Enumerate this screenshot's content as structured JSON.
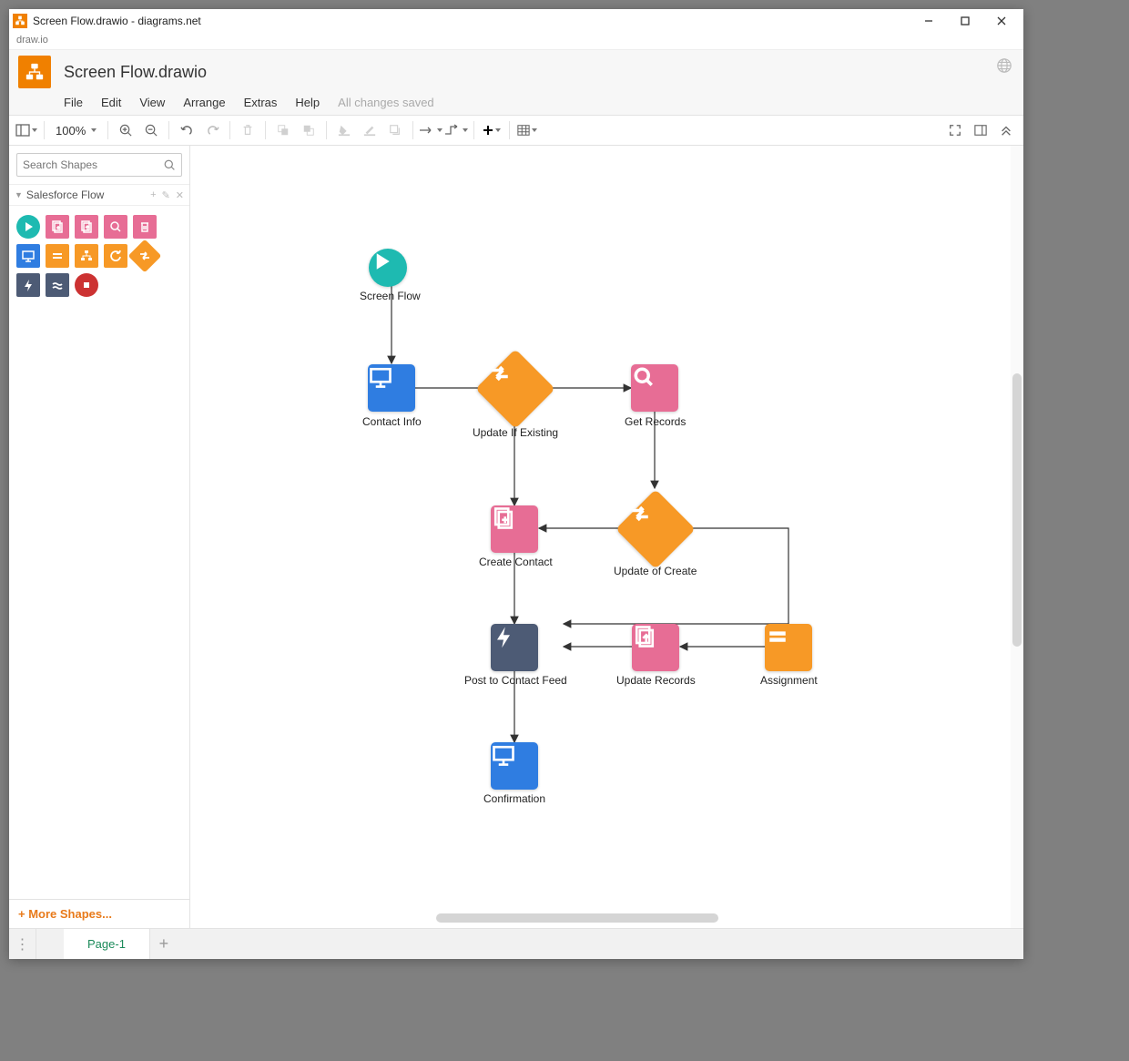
{
  "window": {
    "title": "Screen Flow.drawio - diagrams.net",
    "subtitle": "draw.io"
  },
  "header": {
    "doc_title": "Screen Flow.drawio",
    "save_status": "All changes saved"
  },
  "menu": {
    "file": "File",
    "edit": "Edit",
    "view": "View",
    "arrange": "Arrange",
    "extras": "Extras",
    "help": "Help"
  },
  "toolbar": {
    "zoom": "100%"
  },
  "search": {
    "placeholder": "Search Shapes"
  },
  "palette": {
    "title": "Salesforce Flow"
  },
  "sidebar": {
    "more_shapes": "More Shapes..."
  },
  "tabs": {
    "page1": "Page-1"
  },
  "nodes": {
    "start": "Screen Flow",
    "contact_info": "Contact Info",
    "update_if_existing": "Update If Existing",
    "get_records": "Get Records",
    "create_contact": "Create Contact",
    "update_of_create": "Update of Create",
    "post_feed": "Post to Contact Feed",
    "update_records": "Update Records",
    "assignment": "Assignment",
    "confirmation": "Confirmation"
  }
}
